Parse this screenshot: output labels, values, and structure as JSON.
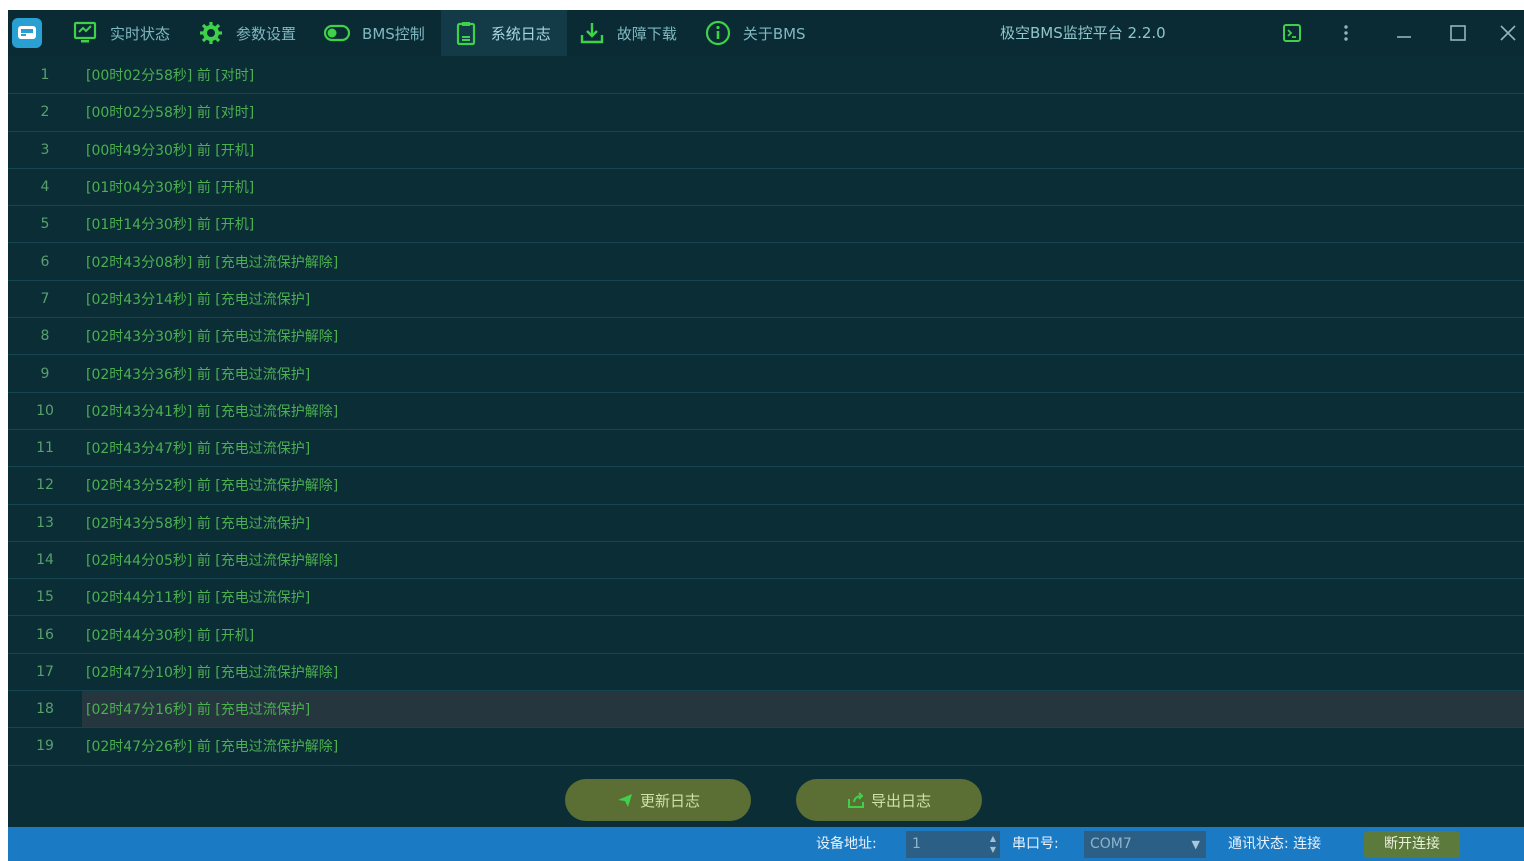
{
  "window": {
    "title": "极空BMS监控平台 2.2.0"
  },
  "tabs": [
    {
      "label": "实时状态",
      "icon": "monitor-icon"
    },
    {
      "label": "参数设置",
      "icon": "gear-icon"
    },
    {
      "label": "BMS控制",
      "icon": "toggle-icon"
    },
    {
      "label": "系统日志",
      "icon": "clipboard-icon",
      "active": true
    },
    {
      "label": "故障下载",
      "icon": "download-icon"
    },
    {
      "label": "关于BMS",
      "icon": "info-icon"
    }
  ],
  "log": {
    "rows": [
      {
        "num": "1",
        "text": "[00时02分58秒] 前 [对时]"
      },
      {
        "num": "2",
        "text": "[00时02分58秒] 前 [对时]"
      },
      {
        "num": "3",
        "text": "[00时49分30秒] 前 [开机]"
      },
      {
        "num": "4",
        "text": "[01时04分30秒] 前 [开机]"
      },
      {
        "num": "5",
        "text": "[01时14分30秒] 前 [开机]"
      },
      {
        "num": "6",
        "text": "[02时43分08秒] 前 [充电过流保护解除]"
      },
      {
        "num": "7",
        "text": "[02时43分14秒] 前 [充电过流保护]"
      },
      {
        "num": "8",
        "text": "[02时43分30秒] 前 [充电过流保护解除]"
      },
      {
        "num": "9",
        "text": "[02时43分36秒] 前 [充电过流保护]"
      },
      {
        "num": "10",
        "text": "[02时43分41秒] 前 [充电过流保护解除]"
      },
      {
        "num": "11",
        "text": "[02时43分47秒] 前 [充电过流保护]"
      },
      {
        "num": "12",
        "text": "[02时43分52秒] 前 [充电过流保护解除]"
      },
      {
        "num": "13",
        "text": "[02时43分58秒] 前 [充电过流保护]"
      },
      {
        "num": "14",
        "text": "[02时44分05秒] 前 [充电过流保护解除]"
      },
      {
        "num": "15",
        "text": "[02时44分11秒] 前 [充电过流保护]"
      },
      {
        "num": "16",
        "text": "[02时44分30秒] 前 [开机]"
      },
      {
        "num": "17",
        "text": "[02时47分10秒] 前 [充电过流保护解除]"
      },
      {
        "num": "18",
        "text": "[02时47分16秒] 前 [充电过流保护]",
        "selected": true
      },
      {
        "num": "19",
        "text": "[02时47分26秒] 前 [充电过流保护解除]"
      }
    ]
  },
  "actions": {
    "refresh_label": "更新日志",
    "export_label": "导出日志"
  },
  "status_bar": {
    "device_address_label": "设备地址:",
    "device_address_value": "1",
    "port_label": "串口号:",
    "port_value": "COM7",
    "comm_status_label": "通讯状态: 连接",
    "disconnect_label": "断开连接"
  },
  "colors": {
    "background": "#0a2d36",
    "log_text": "#4caf50",
    "status_bar": "#1a7ac4",
    "action_button": "#5b6f35",
    "accent_green": "#3fd14a"
  }
}
